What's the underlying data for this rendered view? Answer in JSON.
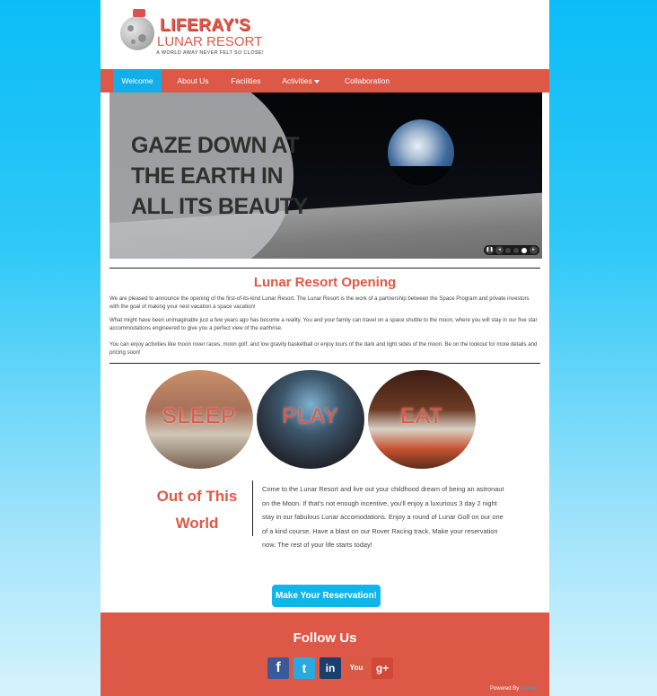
{
  "logo": {
    "title": "LIFERAY'S",
    "subtitle": "LUNAR RESORT",
    "tagline": "A WORLD AWAY NEVER FELT SO CLOSE!"
  },
  "nav": {
    "items": [
      "Welcome",
      "About Us",
      "Facilities",
      "Activities",
      "Collaboration"
    ],
    "active": "Welcome"
  },
  "hero": {
    "headline": [
      "GAZE DOWN AT",
      "THE EARTH IN",
      "ALL ITS BEAUTY"
    ],
    "controls": [
      "pause",
      "prev",
      "dot",
      "dot",
      "dot",
      "next"
    ]
  },
  "intro": {
    "title": "Lunar Resort Opening",
    "paragraphs": [
      "We are pleased to announce the opening of the first-of-its-kind Lunar Resort. The Lunar Resort is the work of a partnership between the Space Program and private investors with the goal of making your next vacation a space vacation!",
      "What might have been unimaginable just a few years ago has become a reality. You and your family can travel on a space shuttle to the moon, where you will stay in our five star accommodations engineered to give you a perfect view of the earthrise.",
      "You can enjoy activities like moon rover races, moon golf, and low gravity basketball or enjoy tours of the dark and light sides of the moon. Be on the lookout for more details and pricing soon!"
    ]
  },
  "circles": [
    {
      "label": "SLEEP"
    },
    {
      "label": "PLAY"
    },
    {
      "label": "EAT"
    }
  ],
  "world": {
    "title": "Out of This World",
    "text": "Come to the Lunar Resort and live out your childhood dream of being an astronaut on the Moon. If that's not enough incentive, you'll enjoy a luxurious 3 day 2 night stay in our fabulous Lunar accomodations. Enjoy a round of Lunar Golf on our one of a kind course. Have a blast on our Rover Racing track. Make your reservation now. The rest of your life starts today!"
  },
  "cta": {
    "label": "Make Your Reservation!"
  },
  "footer": {
    "follow": "Follow Us",
    "social": [
      {
        "name": "facebook",
        "glyph": "f",
        "color": "#3b5998"
      },
      {
        "name": "twitter",
        "glyph": "t",
        "color": "#2aa9e0"
      },
      {
        "name": "linkedin",
        "glyph": "in",
        "color": "#1a3e6e"
      },
      {
        "name": "youtube",
        "glyph": "You",
        "color": "#d85a44"
      },
      {
        "name": "google-plus",
        "glyph": "g+",
        "color": "#d14836"
      }
    ],
    "powered_prefix": "Powered By",
    "powered_brand": "Liferay"
  },
  "colors": {
    "accent": "#de5847",
    "nav_active": "#12aee9",
    "cta": "#12b5ea"
  }
}
